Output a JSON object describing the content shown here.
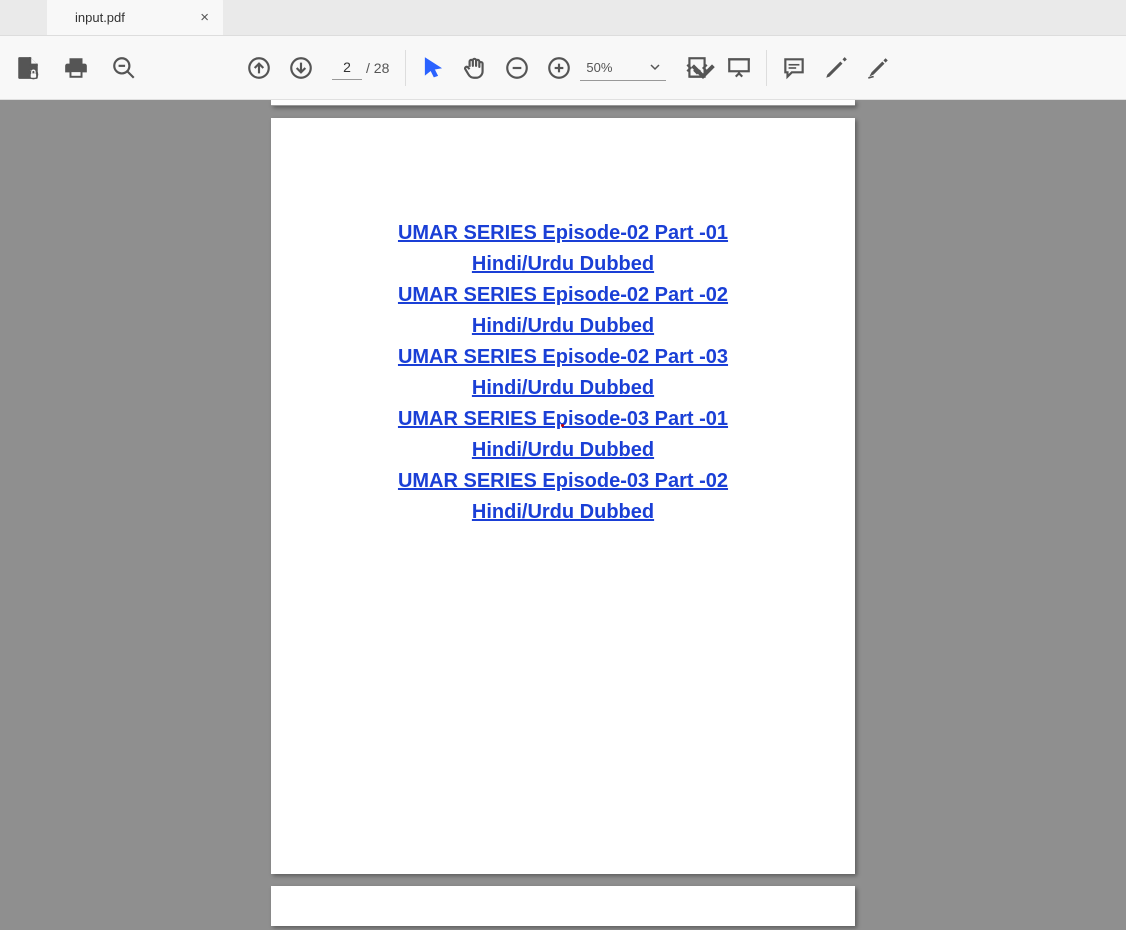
{
  "tab": {
    "title": "input.pdf"
  },
  "toolbar": {
    "page_current": "2",
    "page_total_prefix": "/",
    "page_total": "28",
    "zoom_label": "50%"
  },
  "document": {
    "links": [
      {
        "line1": "UMAR SERIES Episode-02 Part -01",
        "line2": "Hindi/Urdu Dubbed"
      },
      {
        "line1": "UMAR SERIES Episode-02 Part -02",
        "line2": "Hindi/Urdu Dubbed"
      },
      {
        "line1": "UMAR SERIES Episode-02 Part -03",
        "line2": "Hindi/Urdu Dubbed"
      },
      {
        "line1": "UMAR SERIES Episode-03 Part -01",
        "line2": "Hindi/Urdu Dubbed"
      },
      {
        "line1": "UMAR SERIES Episode-03 Part -02",
        "line2": "Hindi/Urdu Dubbed"
      }
    ]
  }
}
